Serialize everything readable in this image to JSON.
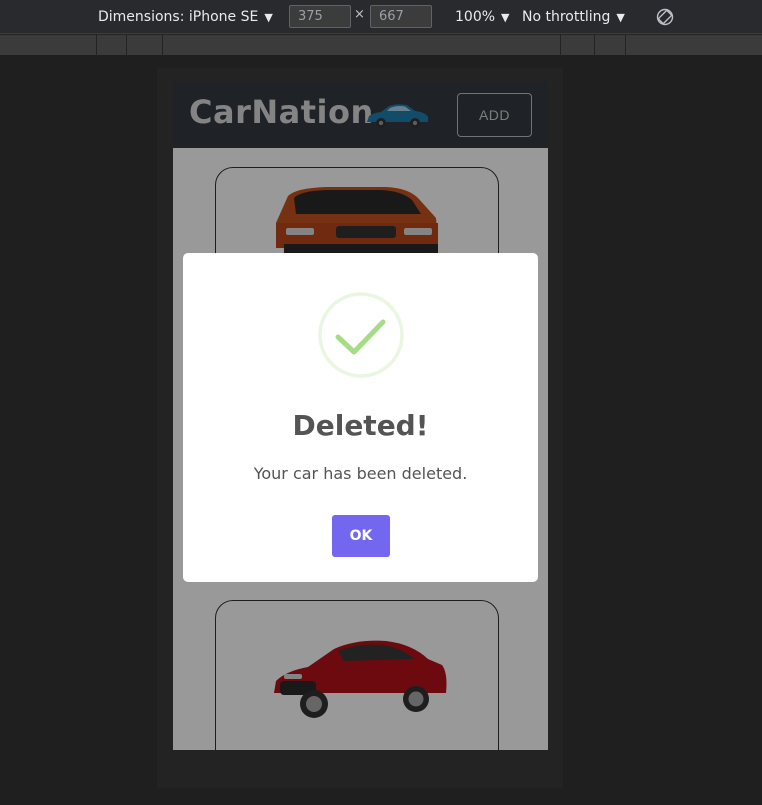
{
  "devtools": {
    "dimensions_label": "Dimensions: iPhone SE",
    "width_value": "375",
    "height_value": "667",
    "times": "×",
    "zoom_label": "100%",
    "throttling_label": "No throttling",
    "caret": "▼"
  },
  "app": {
    "brand": "CarNation",
    "add_button": "ADD",
    "colors": {
      "navbar": "#343a40",
      "accent": "#7367f0",
      "success": "#a5dc86"
    }
  },
  "cards": [
    {
      "car_color": "#c5501e",
      "car_model": "orange-suv"
    },
    {
      "car_color": "#b5121b",
      "car_model": "red-coupe"
    }
  ],
  "modal": {
    "icon": "success-check-icon",
    "title": "Deleted!",
    "text": "Your car has been deleted.",
    "ok_button": "OK"
  }
}
